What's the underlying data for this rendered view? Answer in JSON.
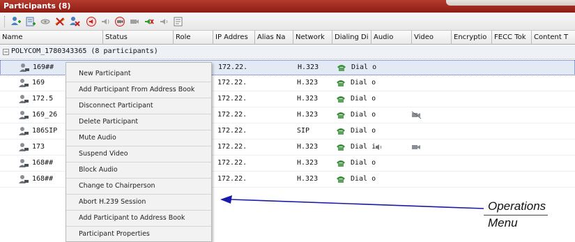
{
  "window": {
    "title": "Participants (8)"
  },
  "toolbar": {
    "icons": [
      "add-participant-icon",
      "add-from-address-book-icon",
      "connect-icon",
      "disconnect-icon",
      "delete-icon",
      "mute-audio-icon",
      "unmute-audio-icon",
      "suspend-video-icon",
      "resume-video-icon",
      "block-audio-icon",
      "unblock-audio-icon",
      "properties-icon"
    ]
  },
  "columns": [
    "Name",
    "Status",
    "Role",
    "IP Addres",
    "Alias Na",
    "Network",
    "Dialing Di",
    "Audio",
    "Video",
    "Encryptio",
    "FECC Tok",
    "Content T"
  ],
  "conference": {
    "label": "POLYCOM_1780343365 (8 participants)",
    "toggle": "⊟"
  },
  "participants": [
    {
      "name": "169##",
      "ip": "172.22.",
      "network": "H.323",
      "dialing": "Dial o",
      "audio": "",
      "video": ""
    },
    {
      "name": "169",
      "ip": "172.22.",
      "network": "H.323",
      "dialing": "Dial o",
      "audio": "",
      "video": ""
    },
    {
      "name": "172.5",
      "ip": "172.22.",
      "network": "H.323",
      "dialing": "Dial o",
      "audio": "",
      "video": ""
    },
    {
      "name": "169_26",
      "ip": "172.22.",
      "network": "H.323",
      "dialing": "Dial o",
      "audio": "",
      "video": "video-muted-icon"
    },
    {
      "name": "186SIP",
      "ip": "172.22.",
      "network": "SIP",
      "dialing": "Dial o",
      "audio": "",
      "video": ""
    },
    {
      "name": "173",
      "ip": "172.22.",
      "network": "H.323",
      "dialing": "Dial i",
      "audio": "audio-muted-icon",
      "video": "video-suspended-icon"
    },
    {
      "name": "168##",
      "ip": "172.22.",
      "network": "H.323",
      "dialing": "Dial o",
      "audio": "",
      "video": ""
    },
    {
      "name": "168##",
      "ip": "172.22.",
      "network": "H.323",
      "dialing": "Dial o",
      "audio": "",
      "video": ""
    }
  ],
  "menu": {
    "items": [
      "New Participant",
      "Add Participant From Address Book",
      "Disconnect Participant",
      "Delete Participant",
      "Mute Audio",
      "Suspend Video",
      "Block Audio",
      "Change to Chairperson",
      "Abort H.239 Session",
      "Add Participant to Address Book",
      "Participant Properties"
    ]
  },
  "callout": {
    "line1": "Operations",
    "line2": "Menu"
  },
  "colors": {
    "title_bar": "#9a241b",
    "arrow": "#1a1aa8",
    "selection": "#e3e9f5"
  }
}
